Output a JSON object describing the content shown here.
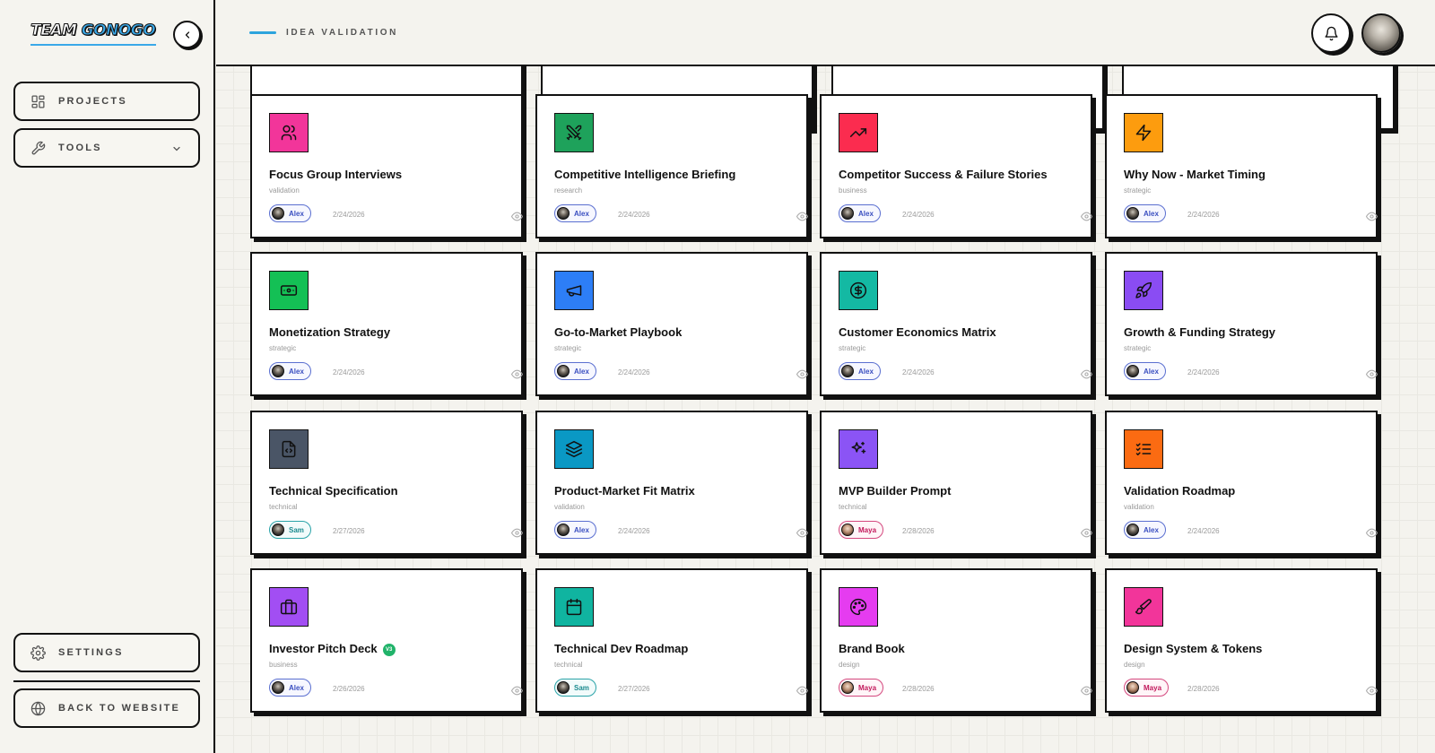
{
  "brand": {
    "logo_part1": "TEAM",
    "logo_part2": "GONOGO"
  },
  "sidebar": {
    "projects_label": "PROJECTS",
    "tools_label": "TOOLS",
    "settings_label": "SETTINGS",
    "back_label": "BACK TO WEBSITE"
  },
  "header": {
    "section_title": "IDEA VALIDATION"
  },
  "colors": {
    "accent": "#2da4dd"
  },
  "cards": [
    {
      "title": "Focus Group Interviews",
      "category": "validation",
      "author": "Alex",
      "date": "2/24/2026",
      "icon": "users-icon",
      "color": "#f2359a"
    },
    {
      "title": "Competitive Intelligence Briefing",
      "category": "research",
      "author": "Alex",
      "date": "2/24/2026",
      "icon": "swords-icon",
      "color": "#1ea25b"
    },
    {
      "title": "Competitor Success & Failure Stories",
      "category": "business",
      "author": "Alex",
      "date": "2/24/2026",
      "icon": "trending-up-icon",
      "color": "#fb2c4f"
    },
    {
      "title": "Why Now - Market Timing",
      "category": "strategic",
      "author": "Alex",
      "date": "2/24/2026",
      "icon": "zap-icon",
      "color": "#fd9c0e"
    },
    {
      "title": "Monetization Strategy",
      "category": "strategic",
      "author": "Alex",
      "date": "2/24/2026",
      "icon": "banknote-icon",
      "color": "#14c055"
    },
    {
      "title": "Go-to-Market Playbook",
      "category": "strategic",
      "author": "Alex",
      "date": "2/24/2026",
      "icon": "megaphone-icon",
      "color": "#2d7ef6"
    },
    {
      "title": "Customer Economics Matrix",
      "category": "strategic",
      "author": "Alex",
      "date": "2/24/2026",
      "icon": "dollar-circle-icon",
      "color": "#14b9a3"
    },
    {
      "title": "Growth & Funding Strategy",
      "category": "strategic",
      "author": "Alex",
      "date": "2/24/2026",
      "icon": "rocket-icon",
      "color": "#8a4cf3"
    },
    {
      "title": "Technical Specification",
      "category": "technical",
      "author": "Sam",
      "date": "2/27/2026",
      "icon": "file-code-icon",
      "color": "#4a5566"
    },
    {
      "title": "Product-Market Fit Matrix",
      "category": "validation",
      "author": "Alex",
      "date": "2/24/2026",
      "icon": "layers-icon",
      "color": "#0a98c4"
    },
    {
      "title": "MVP Builder Prompt",
      "category": "technical",
      "author": "Maya",
      "date": "2/28/2026",
      "icon": "sparkles-icon",
      "color": "#8b54f5"
    },
    {
      "title": "Validation Roadmap",
      "category": "validation",
      "author": "Alex",
      "date": "2/24/2026",
      "icon": "list-checks-icon",
      "color": "#fb6b12"
    },
    {
      "title": "Investor Pitch Deck",
      "category": "business",
      "author": "Alex",
      "date": "2/26/2026",
      "icon": "briefcase-icon",
      "color": "#a24ef3",
      "badge": "V3"
    },
    {
      "title": "Technical Dev Roadmap",
      "category": "technical",
      "author": "Sam",
      "date": "2/27/2026",
      "icon": "calendar-icon",
      "color": "#10b4a0"
    },
    {
      "title": "Brand Book",
      "category": "design",
      "author": "Maya",
      "date": "2/28/2026",
      "icon": "palette-icon",
      "color": "#e53cf0"
    },
    {
      "title": "Design System & Tokens",
      "category": "design",
      "author": "Maya",
      "date": "2/28/2026",
      "icon": "paintbrush-icon",
      "color": "#f2359a"
    }
  ]
}
